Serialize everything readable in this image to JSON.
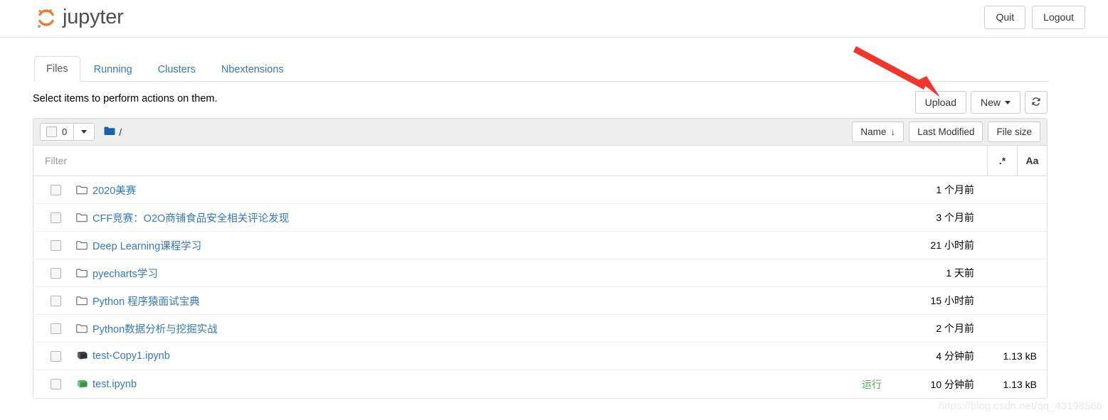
{
  "header": {
    "brand": "jupyter",
    "buttons": [
      {
        "label": "Quit",
        "name": "quit-button"
      },
      {
        "label": "Logout",
        "name": "logout-button"
      }
    ]
  },
  "tabs": [
    {
      "label": "Files",
      "active": true
    },
    {
      "label": "Running",
      "active": false
    },
    {
      "label": "Clusters",
      "active": false
    },
    {
      "label": "Nbextensions",
      "active": false
    }
  ],
  "notice": "Select items to perform actions on them.",
  "actions": {
    "upload": "Upload",
    "new": "New",
    "refresh_icon": "refresh-icon"
  },
  "list_header": {
    "selected_count": "0",
    "breadcrumb_root": "/",
    "folder_icon": "folder-icon",
    "sort_buttons": [
      {
        "label": "Name",
        "arrow": "↓",
        "name": "sort-by-name-button"
      },
      {
        "label": "Last Modified",
        "arrow": "",
        "name": "sort-by-last-modified-button"
      },
      {
        "label": "File size",
        "arrow": "",
        "name": "sort-by-file-size-button"
      }
    ]
  },
  "filter": {
    "value": "",
    "placeholder": "Filter",
    "regex_label": ".*",
    "case_label": "Aa"
  },
  "files": [
    {
      "name": "2020美赛",
      "type": "folder",
      "icon": "folder-outline-icon",
      "modified": "1 个月前",
      "size": "",
      "running": ""
    },
    {
      "name": "CFF竞赛：O2O商铺食品安全相关评论发现",
      "type": "folder",
      "icon": "folder-outline-icon",
      "modified": "3 个月前",
      "size": "",
      "running": ""
    },
    {
      "name": "Deep Learning课程学习",
      "type": "folder",
      "icon": "folder-outline-icon",
      "modified": "21 小时前",
      "size": "",
      "running": ""
    },
    {
      "name": "pyecharts学习",
      "type": "folder",
      "icon": "folder-outline-icon",
      "modified": "1 天前",
      "size": "",
      "running": ""
    },
    {
      "name": "Python 程序猿面试宝典",
      "type": "folder",
      "icon": "folder-outline-icon",
      "modified": "15 小时前",
      "size": "",
      "running": ""
    },
    {
      "name": "Python数据分析与挖掘实战",
      "type": "folder",
      "icon": "folder-outline-icon",
      "modified": "2 个月前",
      "size": "",
      "running": ""
    },
    {
      "name": "test-Copy1.ipynb",
      "type": "notebook",
      "icon": "notebook-icon",
      "modified": "4 分钟前",
      "size": "1.13 kB",
      "running": ""
    },
    {
      "name": "test.ipynb",
      "type": "notebook-running",
      "icon": "notebook-running-icon",
      "modified": "10 分钟前",
      "size": "1.13 kB",
      "running": "运行"
    }
  ],
  "watermark": "https://blog.csdn.net/qq_43198568",
  "colors": {
    "brand_orange": "#f37726",
    "link_blue": "#337ab7",
    "running_green": "#5aa75a",
    "arrow_red": "#f0352b",
    "folder_blue": "#1e63a8"
  }
}
